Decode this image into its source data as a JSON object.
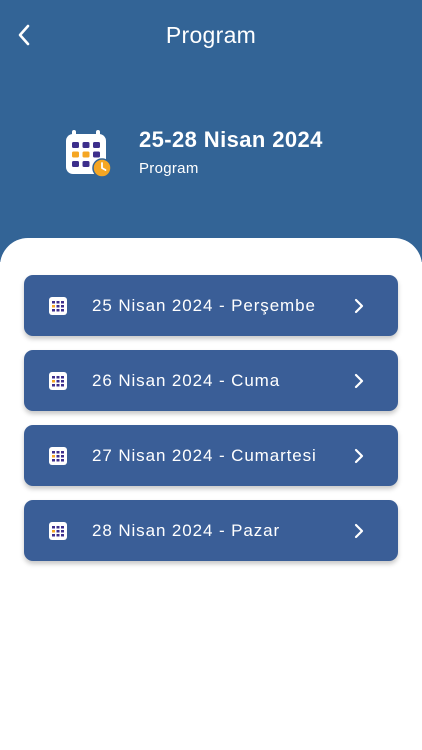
{
  "header": {
    "title": "Program",
    "back_icon": "chevron-left-icon"
  },
  "hero": {
    "icon": "calendar-clock-icon",
    "title": "25-28 Nisan 2024",
    "subtitle": "Program"
  },
  "days": [
    {
      "label": "25 Nisan 2024 - Perşembe"
    },
    {
      "label": "26 Nisan 2024 - Cuma"
    },
    {
      "label": "27 Nisan 2024 - Cumartesi"
    },
    {
      "label": "28 Nisan 2024 - Pazar"
    }
  ],
  "colors": {
    "header_bg": "#336496",
    "item_bg": "#3a5e97",
    "accent_orange": "#f5a623",
    "icon_purple": "#3d2e8c"
  }
}
